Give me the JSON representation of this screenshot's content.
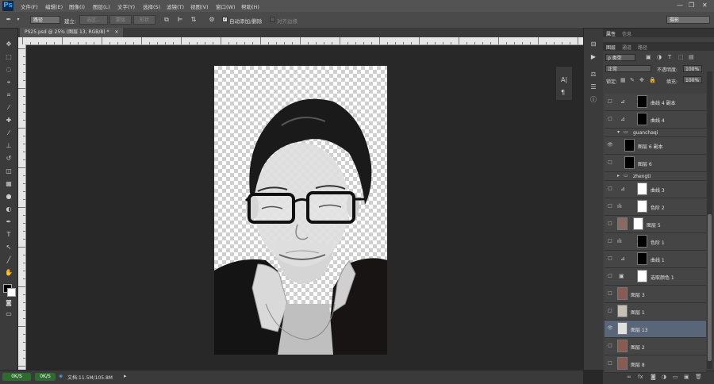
{
  "app": {
    "logo": "Ps"
  },
  "menu": [
    "文件(F)",
    "编辑(E)",
    "图像(I)",
    "图层(L)",
    "文字(Y)",
    "选择(S)",
    "滤镜(T)",
    "视图(V)",
    "窗口(W)",
    "帮助(H)"
  ],
  "window_controls": {
    "minimize": "—",
    "restore": "❐",
    "close": "✕"
  },
  "options": {
    "mode": "路径",
    "make_label": "建立:",
    "make_buttons": [
      "选区...",
      "蒙版",
      "形状"
    ],
    "auto_add_delete": "自动添加/删除",
    "align_edges": "对齐边缘",
    "workspace": "摄影"
  },
  "document": {
    "tab": "PS25.psd @ 25% (图层 13, RGB/8) *",
    "close": "×"
  },
  "status": {
    "left1": "0K/S",
    "left2": "0K/S",
    "info": "文档:11.5M/105.8M"
  },
  "panel": {
    "top_tabs": [
      "属性",
      "信息"
    ],
    "tabs": [
      "图层",
      "通道",
      "路径"
    ],
    "kind_filter": "ρ 类型",
    "blend_mode": "正常",
    "opacity_label": "不透明度:",
    "opacity": "100%",
    "lock_label": "锁定:",
    "fill_label": "填充:",
    "fill": "100%"
  },
  "layers": [
    {
      "name": "曲线 4 副本"
    },
    {
      "name": "曲线 4"
    },
    {
      "name": "guanchaqi",
      "group": true,
      "open": true
    },
    {
      "name": "图层 6 副本"
    },
    {
      "name": "图层 6"
    },
    {
      "name": "zhengti",
      "group": true,
      "open": false
    },
    {
      "name": "曲线 3"
    },
    {
      "name": "色阶 2"
    },
    {
      "name": "图层 5"
    },
    {
      "name": "色阶 1"
    },
    {
      "name": "曲线 1"
    },
    {
      "name": "选取颜色 1"
    },
    {
      "name": "图层 3"
    },
    {
      "name": "图层 1"
    },
    {
      "name": "图层 13",
      "selected": true
    },
    {
      "name": "图层 2"
    },
    {
      "name": "图层 8"
    }
  ]
}
